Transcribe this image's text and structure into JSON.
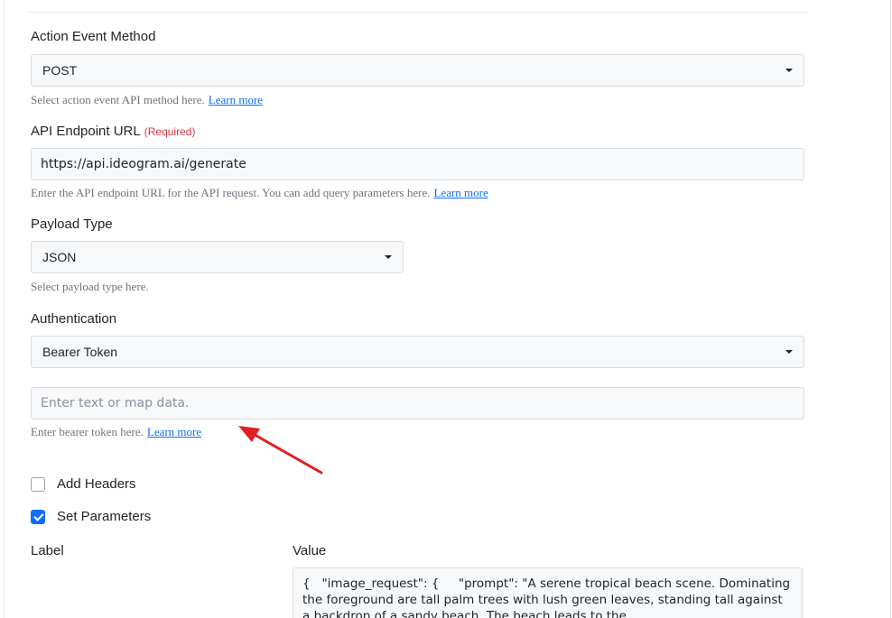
{
  "action_event_method": {
    "label": "Action Event Method",
    "value": "POST",
    "help": "Select action event API method here.",
    "help_link": "Learn more"
  },
  "api_endpoint": {
    "label": "API Endpoint URL",
    "required_text": "(Required)",
    "value": "https://api.ideogram.ai/generate",
    "help": "Enter the API endpoint URL for the API request. You can add query parameters here.",
    "help_link": "Learn more"
  },
  "payload_type": {
    "label": "Payload Type",
    "value": "JSON",
    "help": "Select payload type here."
  },
  "authentication": {
    "label": "Authentication",
    "value": "Bearer Token",
    "token_placeholder": "Enter text or map data.",
    "help": "Enter bearer token here.",
    "help_link": "Learn more"
  },
  "options": {
    "add_headers": {
      "label": "Add Headers",
      "checked": false
    },
    "set_parameters": {
      "label": "Set Parameters",
      "checked": true
    }
  },
  "parameters": {
    "label_header": "Label",
    "value_header": "Value",
    "value_text": "{   \"image_request\": {     \"prompt\": \"A serene tropical beach scene. Dominating the foreground are tall palm trees with lush green leaves, standing tall against a backdrop of a sandy beach. The beach leads to the"
  },
  "colors": {
    "annotation_arrow": "#e02020",
    "checkbox_checked": "#0d6efd",
    "link": "#0d6efd",
    "required": "#dc3545"
  }
}
